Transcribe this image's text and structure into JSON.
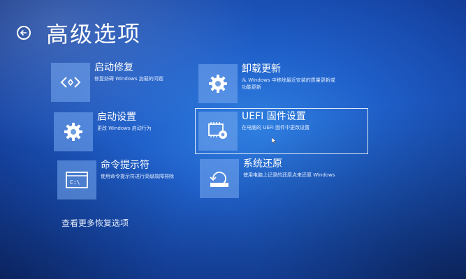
{
  "page": {
    "title": "高级选项"
  },
  "tiles": [
    {
      "id": "startup-repair",
      "title": "启动修复",
      "desc": "修复妨碍 Windows 加载的问题",
      "icon": "code-brackets-icon"
    },
    {
      "id": "uninstall-updates",
      "title": "卸载更新",
      "desc": "从 Windows 中移除最近安装的质量更新或功能更新",
      "icon": "gear-icon"
    },
    {
      "id": "startup-settings",
      "title": "启动设置",
      "desc": "更改 Windows 启动行为",
      "icon": "gear-icon"
    },
    {
      "id": "uefi-firmware",
      "title": "UEFI 固件设置",
      "desc": "在电脑的 UEFI 固件中更改设置",
      "icon": "chip-gear-icon"
    },
    {
      "id": "command-prompt",
      "title": "命令提示符",
      "desc": "使用命令提示符进行高级故障排除",
      "icon": "terminal-icon"
    },
    {
      "id": "system-restore",
      "title": "系统还原",
      "desc": "使用电脑上记录的还原点来还原 Windows",
      "icon": "restore-icon"
    }
  ],
  "more_link": "查看更多恢复选项"
}
